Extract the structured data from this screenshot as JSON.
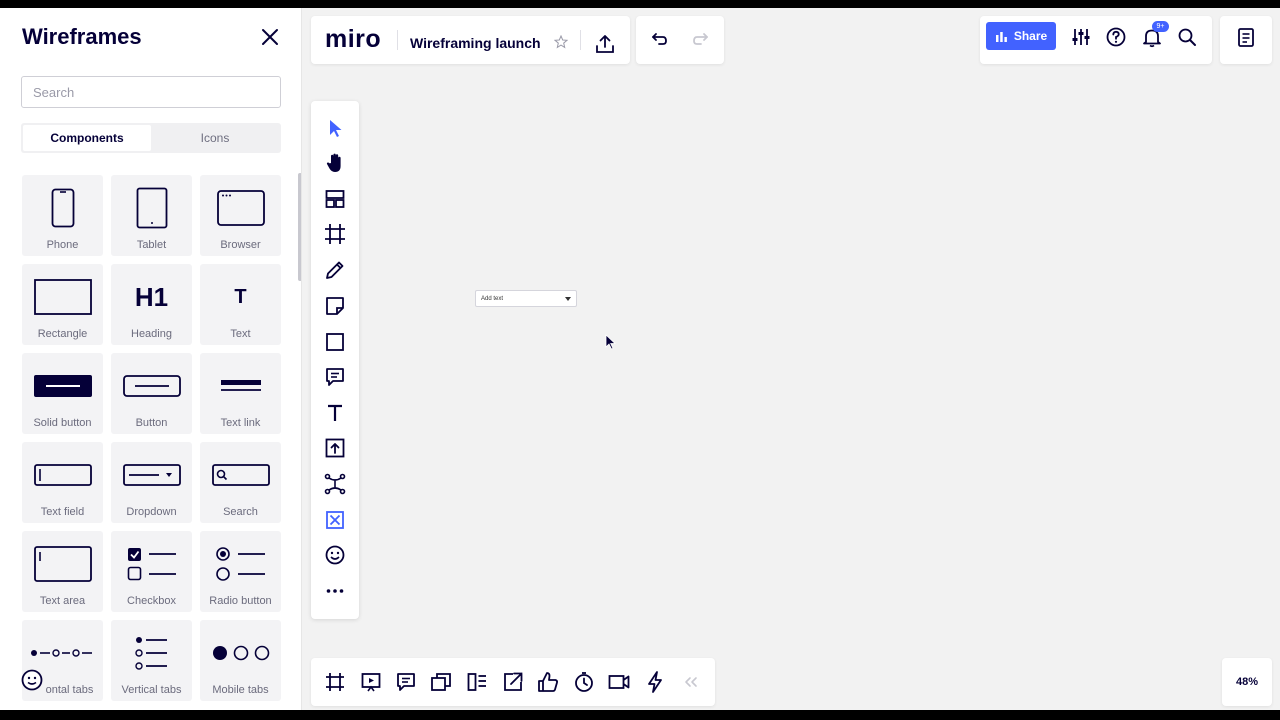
{
  "colors": {
    "accent": "#4262ff",
    "ink": "#050038",
    "canvas": "#f2f2f2"
  },
  "panel": {
    "title": "Wireframes",
    "search_placeholder": "Search",
    "tabs": [
      {
        "label": "Components",
        "active": true
      },
      {
        "label": "Icons",
        "active": false
      }
    ],
    "components": [
      {
        "label": "Phone",
        "icon": "phone-icon"
      },
      {
        "label": "Tablet",
        "icon": "tablet-icon"
      },
      {
        "label": "Browser",
        "icon": "browser-icon"
      },
      {
        "label": "Rectangle",
        "icon": "rectangle-icon"
      },
      {
        "label": "Heading",
        "icon": "heading-icon",
        "glyph": "H1"
      },
      {
        "label": "Text",
        "icon": "text-icon",
        "glyph": "T"
      },
      {
        "label": "Solid button",
        "icon": "solid-button-icon"
      },
      {
        "label": "Button",
        "icon": "button-icon"
      },
      {
        "label": "Text link",
        "icon": "text-link-icon"
      },
      {
        "label": "Text field",
        "icon": "text-field-icon"
      },
      {
        "label": "Dropdown",
        "icon": "dropdown-icon"
      },
      {
        "label": "Search",
        "icon": "search-field-icon"
      },
      {
        "label": "Text area",
        "icon": "text-area-icon"
      },
      {
        "label": "Checkbox",
        "icon": "checkbox-icon"
      },
      {
        "label": "Radio button",
        "icon": "radio-button-icon"
      },
      {
        "label": "ontal tabs",
        "icon": "horizontal-tabs-icon"
      },
      {
        "label": "Vertical tabs",
        "icon": "vertical-tabs-icon"
      },
      {
        "label": "Mobile tabs",
        "icon": "mobile-tabs-icon"
      }
    ]
  },
  "header": {
    "logo": "miro",
    "board_name": "Wireframing launch",
    "share_label": "Share",
    "notification_count": "9+"
  },
  "toolbar": {
    "tools": [
      "select-icon",
      "hand-icon",
      "templates-icon",
      "frame-icon",
      "pen-icon",
      "sticky-note-icon",
      "shape-icon",
      "comment-icon",
      "text-icon",
      "upload-icon",
      "mind-map-icon",
      "wireframe-icon",
      "emoji-icon",
      "more-icon"
    ]
  },
  "canvas": {
    "dropdown_text": "Add text"
  },
  "bottom_toolbar": {
    "tools": [
      "frames-icon",
      "presentation-icon",
      "comments-icon",
      "cards-icon",
      "kanban-icon",
      "share-link-icon",
      "vote-icon",
      "timer-icon",
      "video-icon",
      "lightning-icon",
      "collapse-icon"
    ]
  },
  "zoom": "48%"
}
